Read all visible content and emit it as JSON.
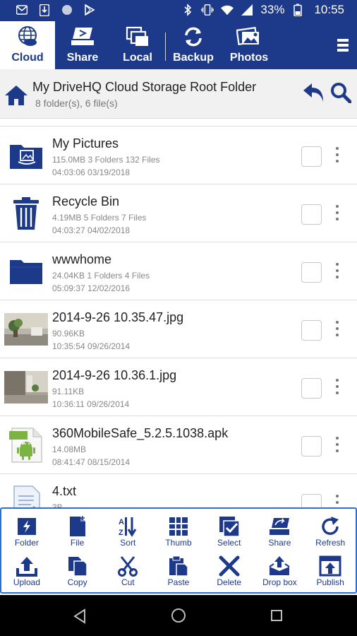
{
  "status_bar": {
    "battery_percent": "33%",
    "time": "10:55",
    "left_icons": [
      "mail-icon",
      "download-icon",
      "circle-icon",
      "play-store-icon"
    ],
    "right_icons": [
      "bluetooth-icon",
      "vibrate-icon",
      "wifi-icon",
      "signal-icon",
      "battery-icon"
    ]
  },
  "tabs": [
    {
      "label": "Cloud",
      "icon": "cloud-globe-icon",
      "active": true
    },
    {
      "label": "Share",
      "icon": "share-icon",
      "active": false
    },
    {
      "label": "Local",
      "icon": "local-files-icon",
      "active": false
    },
    {
      "label": "Backup",
      "icon": "backup-icon",
      "active": false
    },
    {
      "label": "Photos",
      "icon": "photos-icon",
      "active": false
    }
  ],
  "header": {
    "title": "My DriveHQ Cloud Storage Root Folder",
    "subtitle": "8 folder(s), 6 file(s)"
  },
  "files": [
    {
      "name": "My Pictures",
      "meta1": "115.0MB 3 Folders  132 Files",
      "meta2": "04:03:06 03/19/2018",
      "kind": "picture-folder"
    },
    {
      "name": "Recycle Bin",
      "meta1": "4.19MB 5 Folders  7 Files",
      "meta2": "04:03:27 04/02/2018",
      "kind": "recycle-bin"
    },
    {
      "name": "wwwhome",
      "meta1": "24.04KB 1 Folders  4 Files",
      "meta2": "05:09:37 12/02/2016",
      "kind": "folder"
    },
    {
      "name": "2014-9-26 10.35.47.jpg",
      "meta1": "90.96KB",
      "meta2": "10:35:54 09/26/2014",
      "kind": "photo-a"
    },
    {
      "name": "2014-9-26 10.36.1.jpg",
      "meta1": "91.11KB",
      "meta2": "10:36:11 09/26/2014",
      "kind": "photo-b"
    },
    {
      "name": "360MobileSafe_5.2.5.1038.apk",
      "meta1": "14.08MB",
      "meta2": "08:41:47 08/15/2014",
      "kind": "apk"
    },
    {
      "name": "4.txt",
      "meta1": "3B",
      "meta2": "",
      "kind": "txt"
    }
  ],
  "apk_badge": "APK",
  "toolbar": {
    "row1": [
      {
        "label": "Folder",
        "icon": "new-folder-icon"
      },
      {
        "label": "File",
        "icon": "new-file-icon"
      },
      {
        "label": "Sort",
        "icon": "sort-icon"
      },
      {
        "label": "Thumb",
        "icon": "thumbnail-grid-icon"
      },
      {
        "label": "Select",
        "icon": "select-icon"
      },
      {
        "label": "Share",
        "icon": "share-icon"
      },
      {
        "label": "Refresh",
        "icon": "refresh-icon"
      }
    ],
    "row2": [
      {
        "label": "Upload",
        "icon": "upload-icon"
      },
      {
        "label": "Copy",
        "icon": "copy-icon"
      },
      {
        "label": "Cut",
        "icon": "scissors-icon"
      },
      {
        "label": "Paste",
        "icon": "paste-icon"
      },
      {
        "label": "Delete",
        "icon": "delete-x-icon"
      },
      {
        "label": "Drop box",
        "icon": "drop-box-icon"
      },
      {
        "label": "Publish",
        "icon": "publish-icon"
      }
    ]
  },
  "colors": {
    "brand_navy": "#1d3a8a",
    "toolbar_border": "#2a6fd3",
    "apk_green": "#7cb342"
  }
}
